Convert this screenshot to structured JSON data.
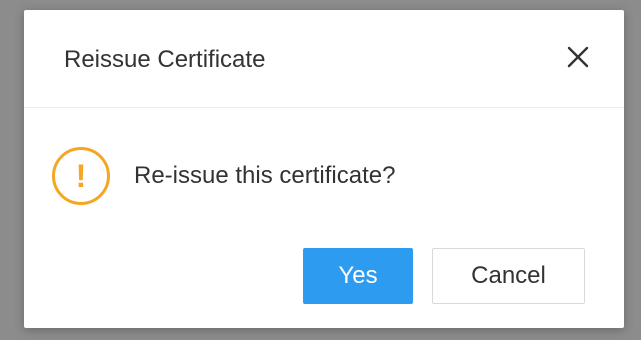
{
  "dialog": {
    "title": "Reissue Certificate",
    "close_icon": "close-icon",
    "warning_icon": "exclamation-circle-icon",
    "message": "Re-issue this certificate?",
    "warning_glyph": "!",
    "buttons": {
      "yes_label": "Yes",
      "cancel_label": "Cancel"
    }
  },
  "colors": {
    "primary": "#2d9bf0",
    "warning": "#f5a623",
    "overlay": "#8c8c8c",
    "text": "#333333"
  }
}
